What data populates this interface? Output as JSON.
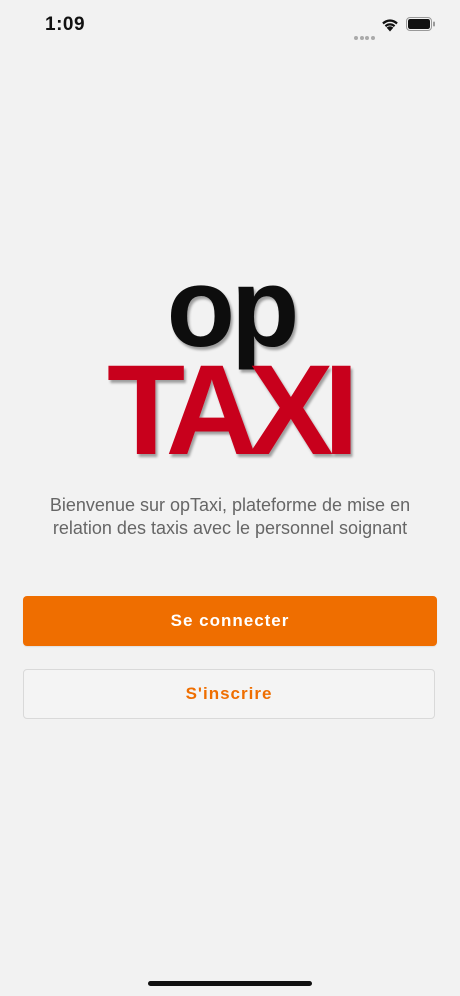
{
  "status_bar": {
    "time": "1:09",
    "icons": [
      "cellular-signal-icon",
      "wifi-icon",
      "battery-icon"
    ]
  },
  "logo": {
    "top_text": "op",
    "bottom_text": "TAXI",
    "colors": {
      "top": "#111111",
      "bottom": "#c8001e"
    }
  },
  "welcome": {
    "text": "Bienvenue sur opTaxi, plateforme de mise en relation des taxis avec le personnel soignant"
  },
  "actions": {
    "login_label": "Se connecter",
    "signup_label": "S'inscrire"
  },
  "colors": {
    "accent": "#ef6e00",
    "background": "#f2f2f2"
  }
}
